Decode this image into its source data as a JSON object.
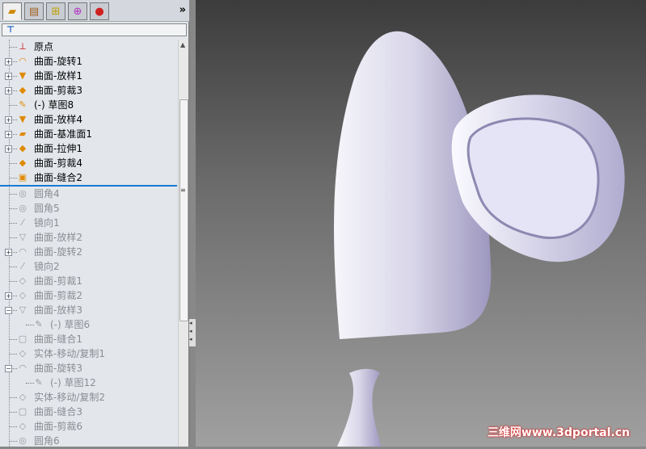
{
  "tabs": [
    {
      "name": "feature-manager",
      "icon": "feature-tree-icon"
    },
    {
      "name": "property-manager",
      "icon": "property-icon"
    },
    {
      "name": "configuration-manager",
      "icon": "configuration-icon"
    },
    {
      "name": "dimxpert-manager",
      "icon": "crosshair-icon"
    },
    {
      "name": "display-manager",
      "icon": "appearance-icon"
    }
  ],
  "more": "»",
  "filter": "⊤",
  "tree": [
    {
      "label": "原点",
      "expand": "",
      "icon": "⊥",
      "suppressed": false,
      "child": false
    },
    {
      "label": "曲面-旋转1",
      "expand": "+",
      "icon": "◠",
      "suppressed": false,
      "child": false
    },
    {
      "label": "曲面-放样1",
      "expand": "+",
      "icon": "▼",
      "suppressed": false,
      "child": false
    },
    {
      "label": "曲面-剪裁3",
      "expand": "+",
      "icon": "◆",
      "suppressed": false,
      "child": false
    },
    {
      "label": "(-) 草图8",
      "expand": "",
      "icon": "✎",
      "suppressed": false,
      "child": false
    },
    {
      "label": "曲面-放样4",
      "expand": "+",
      "icon": "▼",
      "suppressed": false,
      "child": false
    },
    {
      "label": "曲面-基准面1",
      "expand": "+",
      "icon": "▰",
      "suppressed": false,
      "child": false
    },
    {
      "label": "曲面-拉伸1",
      "expand": "+",
      "icon": "◆",
      "suppressed": false,
      "child": false
    },
    {
      "label": "曲面-剪裁4",
      "expand": "",
      "icon": "◆",
      "suppressed": false,
      "child": false
    },
    {
      "label": "曲面-缝合2",
      "expand": "",
      "icon": "▣",
      "suppressed": false,
      "child": false
    },
    {
      "label": "圆角4",
      "expand": "",
      "icon": "◎",
      "suppressed": true,
      "child": false
    },
    {
      "label": "圆角5",
      "expand": "",
      "icon": "◎",
      "suppressed": true,
      "child": false
    },
    {
      "label": "镜向1",
      "expand": "",
      "icon": "⁄",
      "suppressed": true,
      "child": false
    },
    {
      "label": "曲面-放样2",
      "expand": "",
      "icon": "▽",
      "suppressed": true,
      "child": false
    },
    {
      "label": "曲面-旋转2",
      "expand": "+",
      "icon": "◠",
      "suppressed": true,
      "child": false
    },
    {
      "label": "镜向2",
      "expand": "",
      "icon": "⁄",
      "suppressed": true,
      "child": false
    },
    {
      "label": "曲面-剪裁1",
      "expand": "",
      "icon": "◇",
      "suppressed": true,
      "child": false
    },
    {
      "label": "曲面-剪裁2",
      "expand": "+",
      "icon": "◇",
      "suppressed": true,
      "child": false
    },
    {
      "label": "曲面-放样3",
      "expand": "−",
      "icon": "▽",
      "suppressed": true,
      "child": false
    },
    {
      "label": "(-) 草图6",
      "expand": "",
      "icon": "✎",
      "suppressed": true,
      "child": true
    },
    {
      "label": "曲面-缝合1",
      "expand": "",
      "icon": "▢",
      "suppressed": true,
      "child": false
    },
    {
      "label": "实体-移动/复制1",
      "expand": "",
      "icon": "◇",
      "suppressed": true,
      "child": false
    },
    {
      "label": "曲面-旋转3",
      "expand": "−",
      "icon": "◠",
      "suppressed": true,
      "child": false
    },
    {
      "label": "(-) 草图12",
      "expand": "",
      "icon": "✎",
      "suppressed": true,
      "child": true
    },
    {
      "label": "实体-移动/复制2",
      "expand": "",
      "icon": "◇",
      "suppressed": true,
      "child": false
    },
    {
      "label": "曲面-缝合3",
      "expand": "",
      "icon": "▢",
      "suppressed": true,
      "child": false
    },
    {
      "label": "曲面-剪裁6",
      "expand": "",
      "icon": "◇",
      "suppressed": true,
      "child": false
    },
    {
      "label": "圆角6",
      "expand": "",
      "icon": "◎",
      "suppressed": true,
      "child": false
    }
  ],
  "watermark": "三维网www.3dportal.cn"
}
